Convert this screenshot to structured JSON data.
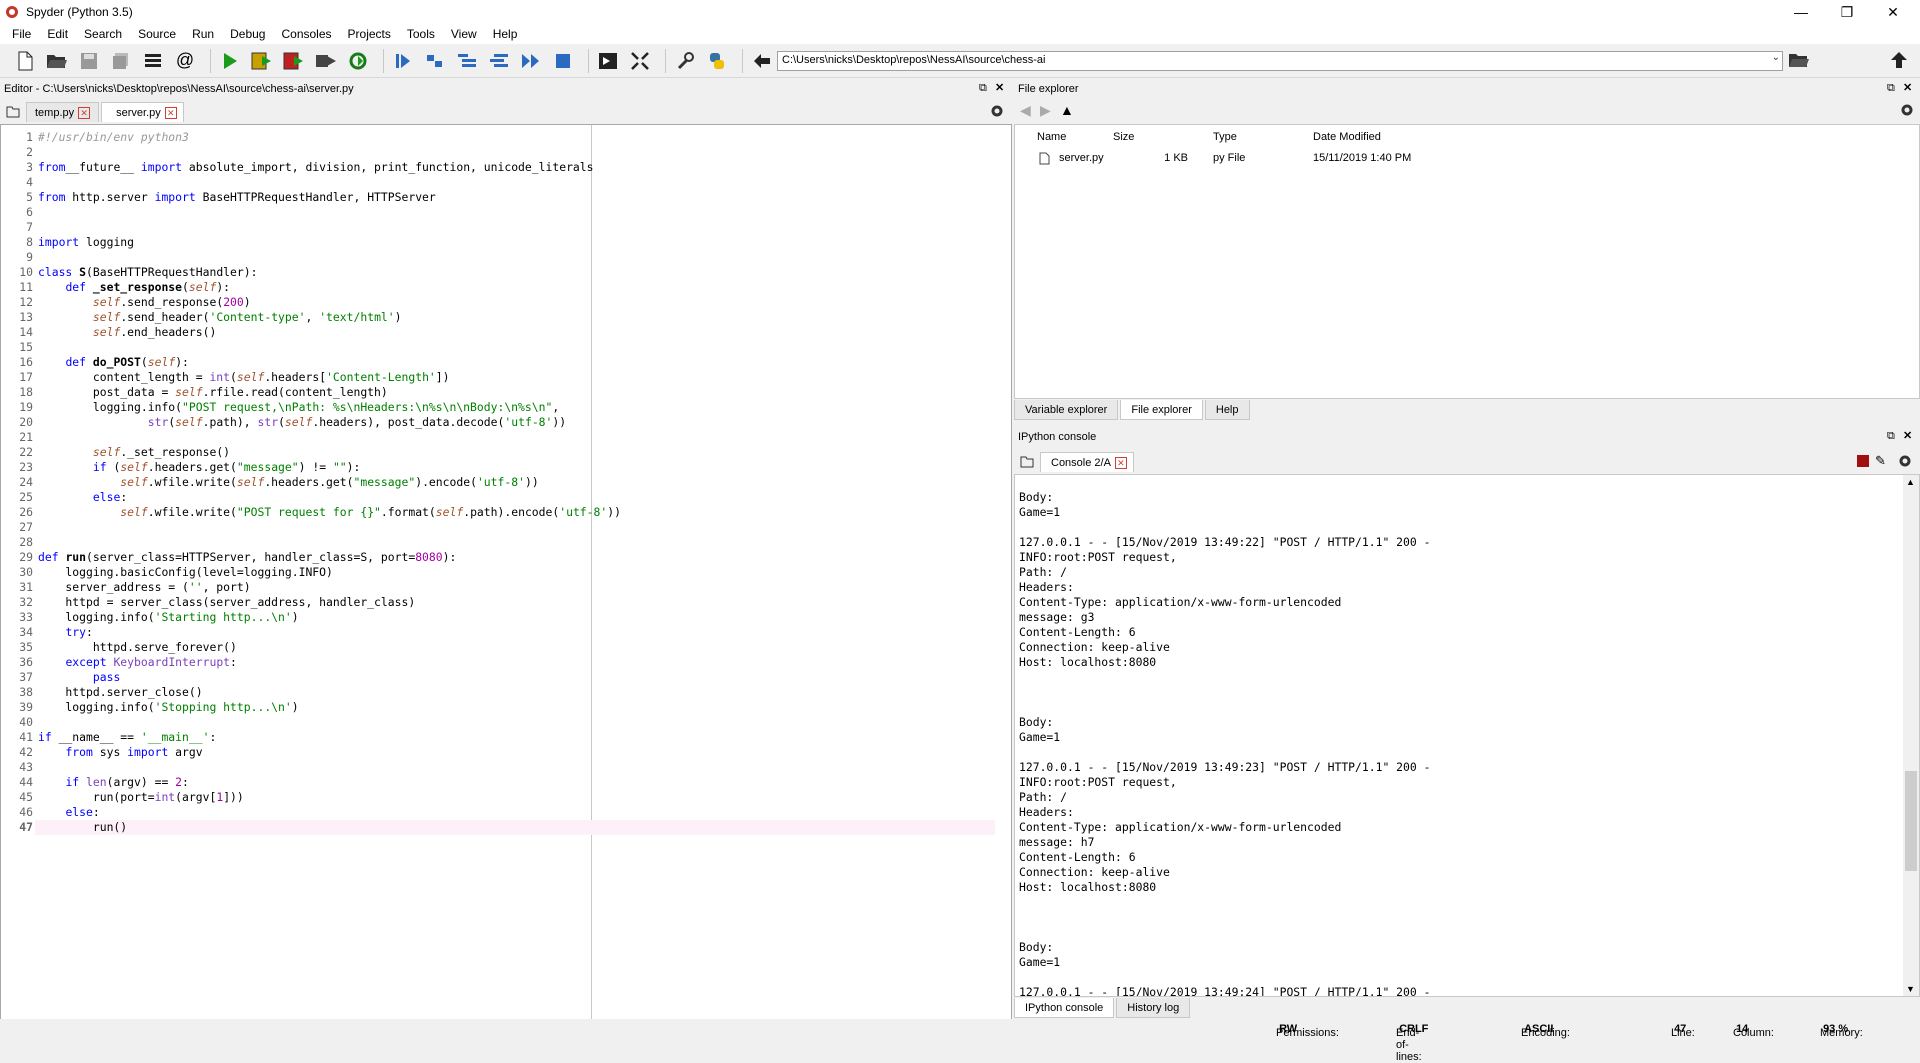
{
  "app": {
    "title": "Spyder (Python 3.5)"
  },
  "menu": [
    "File",
    "Edit",
    "Search",
    "Source",
    "Run",
    "Debug",
    "Consoles",
    "Projects",
    "Tools",
    "View",
    "Help"
  ],
  "toolbar": {
    "path": "C:\\Users\\nicks\\Desktop\\repos\\NessAI\\source\\chess-ai"
  },
  "editor": {
    "title": "Editor - C:\\Users\\nicks\\Desktop\\repos\\NessAI\\source\\chess-ai\\server.py",
    "tabs": [
      {
        "label": "temp.py"
      },
      {
        "label": "server.py"
      }
    ],
    "current_line": 47
  },
  "file_explorer": {
    "title": "File explorer",
    "columns": [
      "Name",
      "Size",
      "Type",
      "Date Modified"
    ],
    "rows": [
      {
        "name": "server.py",
        "size": "1 KB",
        "type": "py File",
        "modified": "15/11/2019 1:40 PM"
      }
    ],
    "bottom_tabs": [
      "Variable explorer",
      "File explorer",
      "Help"
    ]
  },
  "console": {
    "title": "IPython console",
    "tab": "Console 2/A",
    "bottom_tabs": [
      "IPython console",
      "History log"
    ],
    "lines": [
      "Body:",
      "Game=1",
      "",
      "127.0.0.1 - - [15/Nov/2019 13:49:22] \"POST / HTTP/1.1\" 200 -",
      "INFO:root:POST request,",
      "Path: /",
      "Headers:",
      "Content-Type: application/x-www-form-urlencoded",
      "message: g3",
      "Content-Length: 6",
      "Connection: keep-alive",
      "Host: localhost:8080",
      "",
      "",
      "",
      "Body:",
      "Game=1",
      "",
      "127.0.0.1 - - [15/Nov/2019 13:49:23] \"POST / HTTP/1.1\" 200 -",
      "INFO:root:POST request,",
      "Path: /",
      "Headers:",
      "Content-Type: application/x-www-form-urlencoded",
      "message: h7",
      "Content-Length: 6",
      "Connection: keep-alive",
      "Host: localhost:8080",
      "",
      "",
      "",
      "Body:",
      "Game=1",
      "",
      "127.0.0.1 - - [15/Nov/2019 13:49:24] \"POST / HTTP/1.1\" 200 -"
    ]
  },
  "status": {
    "permissions_label": "Permissions:",
    "permissions": "RW",
    "eol_label": "End-of-lines:",
    "eol": "CRLF",
    "encoding_label": "Encoding:",
    "encoding": "ASCII",
    "line_label": "Line:",
    "line": "47",
    "column_label": "Column:",
    "column": "14",
    "memory_label": "Memory:",
    "memory": "93 %"
  },
  "code": [
    [
      [
        "cm",
        "#!/usr/bin/env python3"
      ]
    ],
    [],
    [
      [
        "kw",
        "from"
      ],
      [
        "",
        "__future__ "
      ],
      [
        "kw",
        "import"
      ],
      [
        "",
        " absolute_import, division, print_function, unicode_literals"
      ]
    ],
    [],
    [
      [
        "kw",
        "from"
      ],
      [
        "",
        " http.server "
      ],
      [
        "kw",
        "import"
      ],
      [
        "",
        " BaseHTTPRequestHandler, HTTPServer"
      ]
    ],
    [],
    [],
    [
      [
        "kw",
        "import"
      ],
      [
        "",
        " logging"
      ]
    ],
    [],
    [
      [
        "kw",
        "class"
      ],
      [
        "",
        " "
      ],
      [
        "fnn",
        "S"
      ],
      [
        "",
        "(BaseHTTPRequestHandler):"
      ]
    ],
    [
      [
        "",
        "    "
      ],
      [
        "kw",
        "def"
      ],
      [
        "",
        " "
      ],
      [
        "fnn",
        "_set_response"
      ],
      [
        "",
        "("
      ],
      [
        "self",
        "self"
      ],
      [
        "",
        "):"
      ]
    ],
    [
      [
        "",
        "        "
      ],
      [
        "self",
        "self"
      ],
      [
        "",
        ".send_response("
      ],
      [
        "num",
        "200"
      ],
      [
        "",
        ")"
      ]
    ],
    [
      [
        "",
        "        "
      ],
      [
        "self",
        "self"
      ],
      [
        "",
        ".send_header("
      ],
      [
        "st",
        "'Content-type'"
      ],
      [
        "",
        ", "
      ],
      [
        "st",
        "'text/html'"
      ],
      [
        "",
        ")"
      ]
    ],
    [
      [
        "",
        "        "
      ],
      [
        "self",
        "self"
      ],
      [
        "",
        ".end_headers()"
      ]
    ],
    [],
    [
      [
        "",
        "    "
      ],
      [
        "kw",
        "def"
      ],
      [
        "",
        " "
      ],
      [
        "fnn",
        "do_POST"
      ],
      [
        "",
        "("
      ],
      [
        "self",
        "self"
      ],
      [
        "",
        "):"
      ]
    ],
    [
      [
        "",
        "        content_length = "
      ],
      [
        "bi",
        "int"
      ],
      [
        "",
        "("
      ],
      [
        "self",
        "self"
      ],
      [
        "",
        ".headers["
      ],
      [
        "st",
        "'Content-Length'"
      ],
      [
        "",
        "])"
      ]
    ],
    [
      [
        "",
        "        post_data = "
      ],
      [
        "self",
        "self"
      ],
      [
        "",
        ".rfile.read(content_length)"
      ]
    ],
    [
      [
        "",
        "        logging.info("
      ],
      [
        "st",
        "\"POST request,\\nPath: %s\\nHeaders:\\n%s\\n\\nBody:\\n%s\\n\""
      ],
      [
        "",
        ","
      ]
    ],
    [
      [
        "",
        "                "
      ],
      [
        "bi",
        "str"
      ],
      [
        "",
        "("
      ],
      [
        "self",
        "self"
      ],
      [
        "",
        ".path), "
      ],
      [
        "bi",
        "str"
      ],
      [
        "",
        "("
      ],
      [
        "self",
        "self"
      ],
      [
        "",
        ".headers), post_data.decode("
      ],
      [
        "st",
        "'utf-8'"
      ],
      [
        "",
        "))"
      ]
    ],
    [],
    [
      [
        "",
        "        "
      ],
      [
        "self",
        "self"
      ],
      [
        "",
        "._set_response()"
      ]
    ],
    [
      [
        "",
        "        "
      ],
      [
        "kw",
        "if"
      ],
      [
        "",
        " ("
      ],
      [
        "self",
        "self"
      ],
      [
        "",
        ".headers.get("
      ],
      [
        "st",
        "\"message\""
      ],
      [
        "",
        ") != "
      ],
      [
        "st",
        "\"\""
      ],
      [
        "",
        "):"
      ]
    ],
    [
      [
        "",
        "            "
      ],
      [
        "self",
        "self"
      ],
      [
        "",
        ".wfile.write("
      ],
      [
        "self",
        "self"
      ],
      [
        "",
        ".headers.get("
      ],
      [
        "st",
        "\"message\""
      ],
      [
        "",
        ").encode("
      ],
      [
        "st",
        "'utf-8'"
      ],
      [
        "",
        "))"
      ]
    ],
    [
      [
        "",
        "        "
      ],
      [
        "kw",
        "else"
      ],
      [
        "",
        ":"
      ]
    ],
    [
      [
        "",
        "            "
      ],
      [
        "self",
        "self"
      ],
      [
        "",
        ".wfile.write("
      ],
      [
        "st",
        "\"POST request for {}\""
      ],
      [
        "",
        ".format("
      ],
      [
        "self",
        "self"
      ],
      [
        "",
        ".path).encode("
      ],
      [
        "st",
        "'utf-8'"
      ],
      [
        "",
        "))"
      ]
    ],
    [],
    [],
    [
      [
        "kw",
        "def"
      ],
      [
        "",
        " "
      ],
      [
        "fnn",
        "run"
      ],
      [
        "",
        "(server_class=HTTPServer, handler_class=S, port="
      ],
      [
        "num",
        "8080"
      ],
      [
        "",
        "):"
      ]
    ],
    [
      [
        "",
        "    logging.basicConfig(level=logging.INFO)"
      ]
    ],
    [
      [
        "",
        "    server_address = ("
      ],
      [
        "st",
        "''"
      ],
      [
        "",
        ", port)"
      ]
    ],
    [
      [
        "",
        "    httpd = server_class(server_address, handler_class)"
      ]
    ],
    [
      [
        "",
        "    logging.info("
      ],
      [
        "st",
        "'Starting http...\\n'"
      ],
      [
        "",
        ")"
      ]
    ],
    [
      [
        "",
        "    "
      ],
      [
        "kw",
        "try"
      ],
      [
        "",
        ":"
      ]
    ],
    [
      [
        "",
        "        httpd.serve_forever()"
      ]
    ],
    [
      [
        "",
        "    "
      ],
      [
        "kw",
        "except"
      ],
      [
        "",
        " "
      ],
      [
        "bi",
        "KeyboardInterrupt"
      ],
      [
        "",
        ":"
      ]
    ],
    [
      [
        "",
        "        "
      ],
      [
        "kw",
        "pass"
      ]
    ],
    [
      [
        "",
        "    httpd.server_close()"
      ]
    ],
    [
      [
        "",
        "    logging.info("
      ],
      [
        "st",
        "'Stopping http...\\n'"
      ],
      [
        "",
        ")"
      ]
    ],
    [],
    [
      [
        "kw",
        "if"
      ],
      [
        "",
        " __name__ == "
      ],
      [
        "st",
        "'__main__'"
      ],
      [
        "",
        ":"
      ]
    ],
    [
      [
        "",
        "    "
      ],
      [
        "kw",
        "from"
      ],
      [
        "",
        " sys "
      ],
      [
        "kw",
        "import"
      ],
      [
        "",
        " argv"
      ]
    ],
    [],
    [
      [
        "",
        "    "
      ],
      [
        "kw",
        "if"
      ],
      [
        "",
        " "
      ],
      [
        "bi",
        "len"
      ],
      [
        "",
        "(argv) == "
      ],
      [
        "num",
        "2"
      ],
      [
        "",
        ":"
      ]
    ],
    [
      [
        "",
        "        run(port="
      ],
      [
        "bi",
        "int"
      ],
      [
        "",
        "(argv["
      ],
      [
        "num",
        "1"
      ],
      [
        "",
        "]))"
      ]
    ],
    [
      [
        "",
        "    "
      ],
      [
        "kw",
        "else"
      ],
      [
        "",
        ":"
      ]
    ],
    [
      [
        "",
        "        run()"
      ]
    ]
  ]
}
